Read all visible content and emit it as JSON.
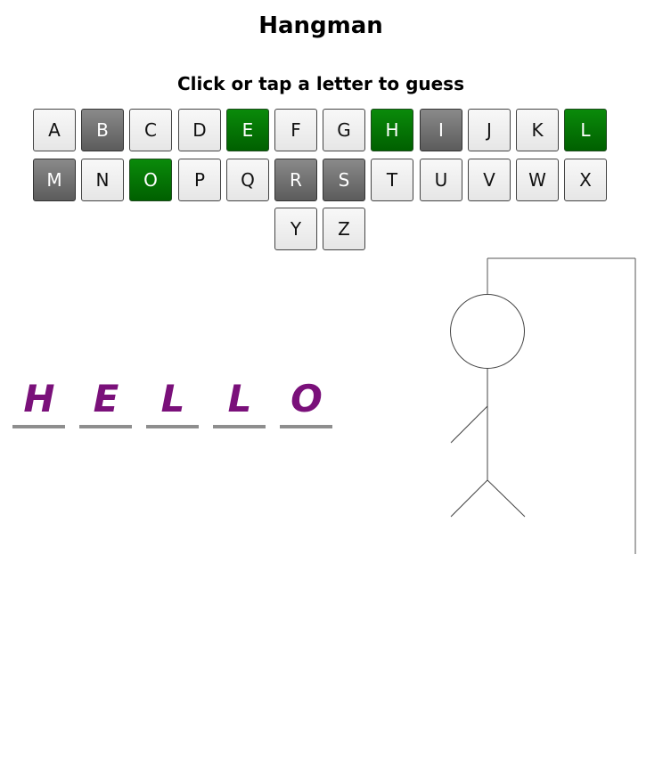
{
  "title": "Hangman",
  "instruction": "Click or tap a letter to guess",
  "keys": [
    {
      "letter": "A",
      "state": "unused"
    },
    {
      "letter": "B",
      "state": "wrong"
    },
    {
      "letter": "C",
      "state": "unused"
    },
    {
      "letter": "D",
      "state": "unused"
    },
    {
      "letter": "E",
      "state": "correct"
    },
    {
      "letter": "F",
      "state": "unused"
    },
    {
      "letter": "G",
      "state": "unused"
    },
    {
      "letter": "H",
      "state": "correct"
    },
    {
      "letter": "I",
      "state": "wrong"
    },
    {
      "letter": "J",
      "state": "unused"
    },
    {
      "letter": "K",
      "state": "unused"
    },
    {
      "letter": "L",
      "state": "correct"
    },
    {
      "letter": "M",
      "state": "wrong"
    },
    {
      "letter": "N",
      "state": "unused"
    },
    {
      "letter": "O",
      "state": "correct"
    },
    {
      "letter": "P",
      "state": "unused"
    },
    {
      "letter": "Q",
      "state": "unused"
    },
    {
      "letter": "R",
      "state": "wrong"
    },
    {
      "letter": "S",
      "state": "wrong"
    },
    {
      "letter": "T",
      "state": "unused"
    },
    {
      "letter": "U",
      "state": "unused"
    },
    {
      "letter": "V",
      "state": "unused"
    },
    {
      "letter": "W",
      "state": "unused"
    },
    {
      "letter": "X",
      "state": "unused"
    },
    {
      "letter": "Y",
      "state": "unused"
    },
    {
      "letter": "Z",
      "state": "unused"
    }
  ],
  "word": [
    "H",
    "E",
    "L",
    "L",
    "O"
  ],
  "colors": {
    "correct": "#006400",
    "wrong": "#666666",
    "unused": "#f0f0f0",
    "word_letters": "#7a107a",
    "underline": "#8e8e8e"
  },
  "hangman_parts_drawn": [
    "gallows",
    "head",
    "body",
    "left-arm",
    "left-leg",
    "right-leg"
  ]
}
